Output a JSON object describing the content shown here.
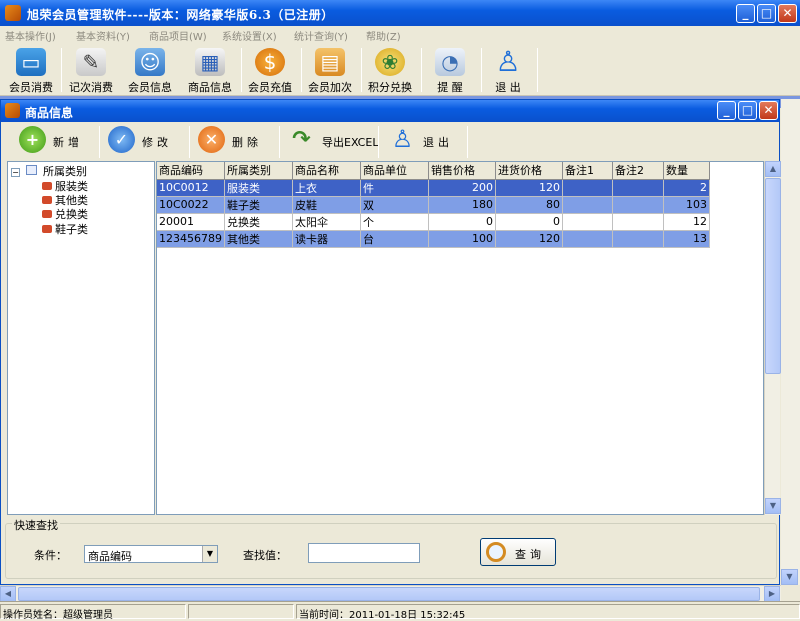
{
  "window": {
    "title": "旭荣会员管理软件----版本：网络豪华版6.3（已注册）"
  },
  "menu": [
    "基本操作(J)",
    "基本资料(Y)",
    "商品项目(W)",
    "系统设置(X)",
    "统计查询(Y)",
    "帮助(Z)"
  ],
  "toolbar": [
    {
      "label": "会员消费",
      "icon": "card-icon"
    },
    {
      "label": "记次消费",
      "icon": "notepad-icon"
    },
    {
      "label": "会员信息",
      "icon": "people-icon"
    },
    {
      "label": "商品信息",
      "icon": "grid-icon"
    },
    {
      "label": "会员充值",
      "icon": "coin-icon"
    },
    {
      "label": "会员加次",
      "icon": "book-icon"
    },
    {
      "label": "积分兑换",
      "icon": "points-icon"
    },
    {
      "label": "提 醒",
      "icon": "reminder-icon"
    },
    {
      "label": "退 出",
      "icon": "exit-icon"
    }
  ],
  "child": {
    "title": "商品信息",
    "tools": {
      "add": "新增",
      "edit": "修改",
      "delete": "删除",
      "export": "导出EXCEL",
      "exit": "退出"
    }
  },
  "tree": {
    "root": "所属类别",
    "items": [
      "服装类",
      "其他类",
      "兑换类",
      "鞋子类"
    ]
  },
  "table": {
    "columns": [
      "商品编码",
      "所属类别",
      "商品名称",
      "商品单位",
      "销售价格",
      "进货价格",
      "备注1",
      "备注2",
      "数量"
    ],
    "rows": [
      [
        "10C0012",
        "服装类",
        "上衣",
        "件",
        "200",
        "120",
        "",
        "",
        "2"
      ],
      [
        "10C0022",
        "鞋子类",
        "皮鞋",
        "双",
        "180",
        "80",
        "",
        "",
        "103"
      ],
      [
        "20001",
        "兑换类",
        "太阳伞",
        "个",
        "0",
        "0",
        "",
        "",
        "12"
      ],
      [
        "123456789",
        "其他类",
        "读卡器",
        "台",
        "100",
        "120",
        "",
        "",
        "13"
      ]
    ]
  },
  "quick_search": {
    "legend": "快速查找",
    "condition_label": "条件：",
    "condition_value": "商品编码",
    "value_label": "查找值：",
    "search_value": "",
    "search_button": "查询"
  },
  "status": {
    "operator": "操作员姓名：超级管理员",
    "time": "当前时间：2011-01-18日 15:32:45"
  },
  "colors": {
    "title_blue": "#0a5ce0",
    "selected_row": "#3e62c6",
    "alt_row": "#7f9ee6"
  }
}
